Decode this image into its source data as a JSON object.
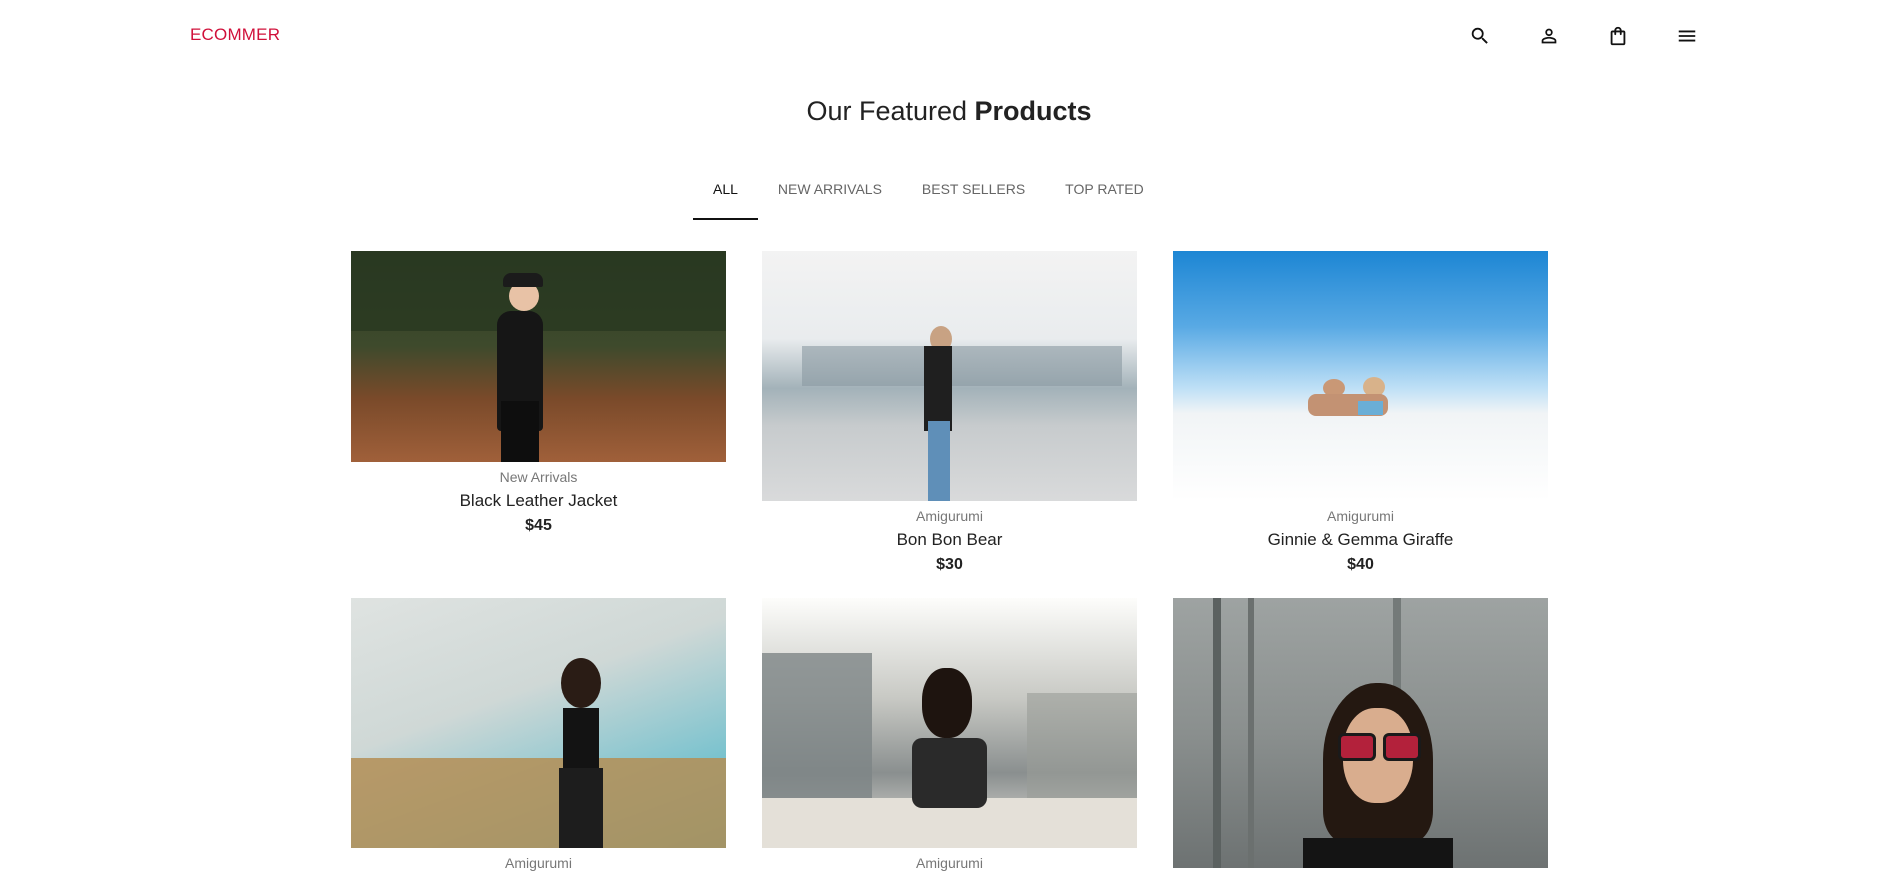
{
  "header": {
    "logo": "ECOMMER",
    "icons": [
      "search-icon",
      "user-icon",
      "shopping-bag-icon",
      "menu-icon"
    ]
  },
  "section": {
    "title_light": "Our Featured",
    "title_bold": "Products"
  },
  "tabs": [
    {
      "label": "ALL",
      "active": true
    },
    {
      "label": "NEW ARRIVALS",
      "active": false
    },
    {
      "label": "BEST SELLERS",
      "active": false
    },
    {
      "label": "TOP RATED",
      "active": false
    }
  ],
  "products": [
    {
      "category": "New Arrivals",
      "name": "Black Leather Jacket",
      "price": "$45"
    },
    {
      "category": "Amigurumi",
      "name": "Bon Bon Bear",
      "price": "$30"
    },
    {
      "category": "Amigurumi",
      "name": "Ginnie & Gemma Giraffe",
      "price": "$40"
    },
    {
      "category": "Amigurumi",
      "name": "",
      "price": ""
    },
    {
      "category": "Amigurumi",
      "name": "",
      "price": ""
    },
    {
      "category": "",
      "name": "",
      "price": ""
    }
  ],
  "colors": {
    "brand": "#d0103a",
    "active_tab_underline": "#111111"
  }
}
